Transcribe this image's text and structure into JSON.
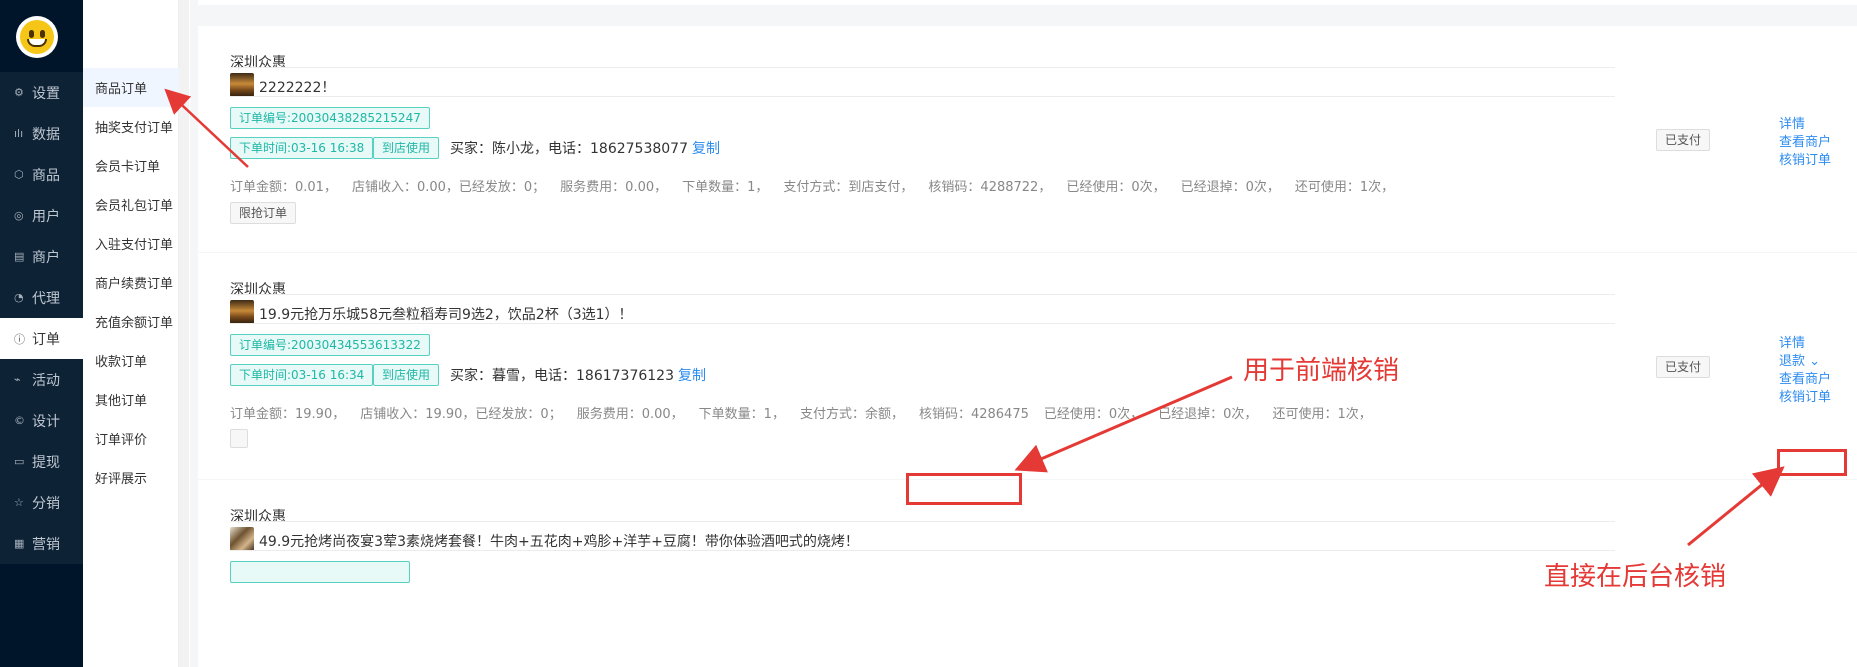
{
  "sidebar": {
    "items": [
      {
        "icon": "gear-icon",
        "glyph": "⚙",
        "label": "设置"
      },
      {
        "icon": "bar-chart-icon",
        "glyph": "ılı",
        "label": "数据"
      },
      {
        "icon": "cube-icon",
        "glyph": "⬡",
        "label": "商品"
      },
      {
        "icon": "user-icon",
        "glyph": "◎",
        "label": "用户"
      },
      {
        "icon": "store-icon",
        "glyph": "▤",
        "label": "商户"
      },
      {
        "icon": "pie-icon",
        "glyph": "◔",
        "label": "代理"
      },
      {
        "icon": "order-icon",
        "glyph": "ⓘ",
        "label": "订单"
      },
      {
        "icon": "tag-icon",
        "glyph": "⌁",
        "label": "活动"
      },
      {
        "icon": "design-icon",
        "glyph": "©",
        "label": "设计"
      },
      {
        "icon": "wallet-icon",
        "glyph": "▭",
        "label": "提现"
      },
      {
        "icon": "star-icon",
        "glyph": "☆",
        "label": "分销"
      },
      {
        "icon": "grid-icon",
        "glyph": "▦",
        "label": "营销"
      }
    ],
    "active_index": 6
  },
  "submenu": {
    "items": [
      "商品订单",
      "抽奖支付订单",
      "会员卡订单",
      "会员礼包订单",
      "入驻支付订单",
      "商户续费订单",
      "充值余额订单",
      "收款订单",
      "其他订单",
      "订单评价",
      "好评展示"
    ],
    "active_index": 0
  },
  "orders": [
    {
      "shop": "深圳众惠",
      "product": "2222222！",
      "order_no": "订单编号:20030438285215247",
      "order_time": "下单时间:03-16 16:38",
      "use_type": "到店使用",
      "buyer": "买家：陈小龙，电话：18627538077",
      "copy": "复制",
      "stats": [
        "订单金额：0.01，",
        "店铺收入：0.00，已经发放：0；",
        "服务费用：0.00，",
        "下单数量：1，",
        "支付方式：到店支付，",
        "核销码：4288722，",
        "已经使用：0次，",
        "已经退掉：0次，",
        "还可使用：1次，"
      ],
      "badge": "限抢订单",
      "status": "已支付",
      "actions": [
        "详情",
        "查看商户",
        "核销订单"
      ]
    },
    {
      "shop": "深圳众惠",
      "product": "19.9元抢万乐城58元叁粒稻寿司9选2，饮品2杯（3选1）！",
      "order_no": "订单编号:20030434553613322",
      "order_time": "下单时间:03-16 16:34",
      "use_type": "到店使用",
      "buyer": "买家：暮雪，电话：18617376123",
      "copy": "复制",
      "stats": [
        "订单金额：19.90，",
        "店铺收入：19.90，已经发放：0；",
        "服务费用：0.00，",
        "下单数量：1，",
        "支付方式：余额，",
        "核销码：4286475",
        "已经使用：0次，",
        "已经退掉：0次，",
        "还可使用：1次，"
      ],
      "badge": "",
      "status": "已支付",
      "actions": [
        "详情",
        "退款 ⌄",
        "查看商户",
        "核销订单"
      ]
    },
    {
      "shop": "深圳众惠",
      "product": "49.9元抢烤尚夜宴3荤3素烧烤套餐！牛肉+五花肉+鸡胗+洋芋+豆腐！带你体验酒吧式的烧烤！"
    }
  ],
  "annotations": {
    "frontend": "用于前端核销",
    "backend": "直接在后台核销"
  },
  "colors": {
    "accent": "#2d8cf0",
    "tag_teal": "#1fb7a6",
    "annotation_red": "#e53935",
    "sidebar_bg": "#001529"
  }
}
